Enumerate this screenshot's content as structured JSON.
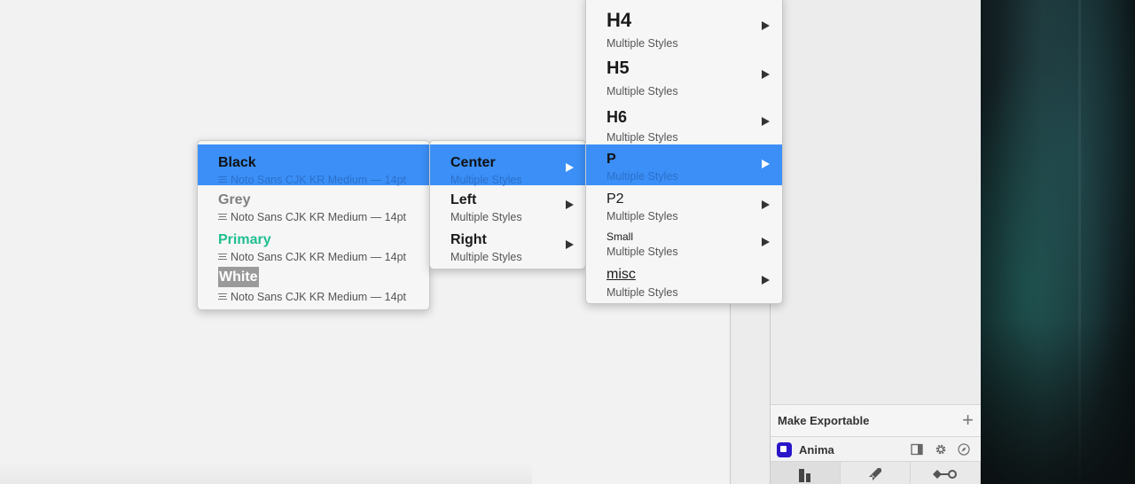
{
  "colors_menu": {
    "items": [
      {
        "title": "Black",
        "subtitle": "Noto Sans CJK KR Medium — 14pt",
        "color": "#1a1a1a",
        "selected": true
      },
      {
        "title": "Grey",
        "subtitle": "Noto Sans CJK KR Medium — 14pt",
        "color": "#808080",
        "selected": false
      },
      {
        "title": "Primary",
        "subtitle": "Noto Sans CJK KR Medium — 14pt",
        "color": "#1fbf8f",
        "selected": false
      },
      {
        "title": "White",
        "subtitle": "Noto Sans CJK KR Medium — 14pt",
        "color": "#ffffff",
        "selected": false
      }
    ]
  },
  "align_menu": {
    "items": [
      {
        "title": "Center",
        "subtitle": "Multiple Styles",
        "selected": true
      },
      {
        "title": "Left",
        "subtitle": "Multiple Styles",
        "selected": false
      },
      {
        "title": "Right",
        "subtitle": "Multiple Styles",
        "selected": false
      }
    ]
  },
  "text_styles_menu": {
    "items": [
      {
        "title": "H4",
        "subtitle": "Multiple Styles",
        "selected": false
      },
      {
        "title": "H5",
        "subtitle": "Multiple Styles",
        "selected": false
      },
      {
        "title": "H6",
        "subtitle": "Multiple Styles",
        "selected": false
      },
      {
        "title": "P",
        "subtitle": "Multiple Styles",
        "selected": true
      },
      {
        "title": "P2",
        "subtitle": "Multiple Styles",
        "selected": false
      },
      {
        "title": "Small",
        "subtitle": "Multiple Styles",
        "selected": false
      },
      {
        "title": "misc",
        "subtitle": "Multiple Styles",
        "selected": false
      }
    ]
  },
  "inspector": {
    "export_label": "Make Exportable",
    "export_add_icon": "plus-icon",
    "plugin_name": "Anima",
    "plugin_icons": [
      "panel-toggle-icon",
      "gear-icon",
      "compass-icon"
    ],
    "tabs": [
      "layout-icon",
      "rocket-icon",
      "connect-icon"
    ]
  },
  "accent_color": "#3b8ff7"
}
